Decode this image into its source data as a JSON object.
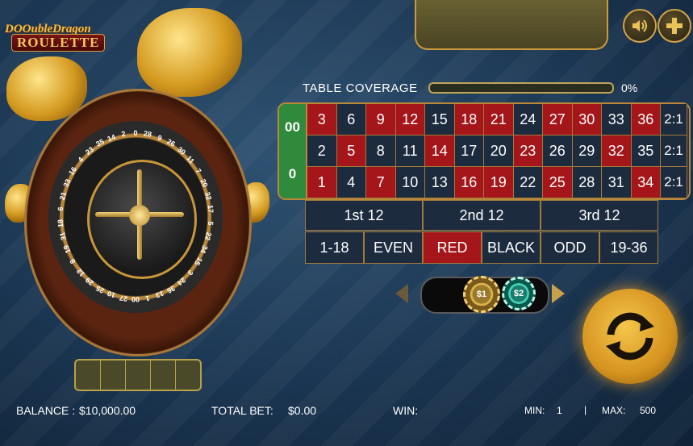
{
  "logo": {
    "line1": "DOOubleDragon",
    "line2": "ROULETTE"
  },
  "coverage": {
    "label": "TABLE COVERAGE",
    "percent_text": "0%",
    "fraction": 0.0
  },
  "table": {
    "zeros": [
      "00",
      "0"
    ],
    "rows": [
      [
        {
          "n": "3",
          "c": "red"
        },
        {
          "n": "6",
          "c": "black"
        },
        {
          "n": "9",
          "c": "red"
        },
        {
          "n": "12",
          "c": "red"
        },
        {
          "n": "15",
          "c": "black"
        },
        {
          "n": "18",
          "c": "red"
        },
        {
          "n": "21",
          "c": "red"
        },
        {
          "n": "24",
          "c": "black"
        },
        {
          "n": "27",
          "c": "red"
        },
        {
          "n": "30",
          "c": "red"
        },
        {
          "n": "33",
          "c": "black"
        },
        {
          "n": "36",
          "c": "red"
        },
        {
          "n": "2:1",
          "c": "col"
        }
      ],
      [
        {
          "n": "2",
          "c": "black"
        },
        {
          "n": "5",
          "c": "red"
        },
        {
          "n": "8",
          "c": "black"
        },
        {
          "n": "11",
          "c": "black"
        },
        {
          "n": "14",
          "c": "red"
        },
        {
          "n": "17",
          "c": "black"
        },
        {
          "n": "20",
          "c": "black"
        },
        {
          "n": "23",
          "c": "red"
        },
        {
          "n": "26",
          "c": "black"
        },
        {
          "n": "29",
          "c": "black"
        },
        {
          "n": "32",
          "c": "red"
        },
        {
          "n": "35",
          "c": "black"
        },
        {
          "n": "2:1",
          "c": "col"
        }
      ],
      [
        {
          "n": "1",
          "c": "red"
        },
        {
          "n": "4",
          "c": "black"
        },
        {
          "n": "7",
          "c": "red"
        },
        {
          "n": "10",
          "c": "black"
        },
        {
          "n": "13",
          "c": "black"
        },
        {
          "n": "16",
          "c": "red"
        },
        {
          "n": "19",
          "c": "red"
        },
        {
          "n": "22",
          "c": "black"
        },
        {
          "n": "25",
          "c": "red"
        },
        {
          "n": "28",
          "c": "black"
        },
        {
          "n": "31",
          "c": "black"
        },
        {
          "n": "34",
          "c": "red"
        },
        {
          "n": "2:1",
          "c": "col"
        }
      ]
    ],
    "dozens": [
      "1st 12",
      "2nd 12",
      "3rd 12"
    ],
    "outside": [
      {
        "label": "1-18",
        "c": "black"
      },
      {
        "label": "EVEN",
        "c": "black"
      },
      {
        "label": "RED",
        "c": "red"
      },
      {
        "label": "BLACK",
        "c": "black"
      },
      {
        "label": "ODD",
        "c": "black"
      },
      {
        "label": "19-36",
        "c": "black"
      }
    ]
  },
  "chips": {
    "chip1": "$1",
    "chip2": "$2"
  },
  "wheel": {
    "numbers": [
      "0",
      "28",
      "9",
      "26",
      "30",
      "11",
      "7",
      "20",
      "32",
      "17",
      "5",
      "22",
      "34",
      "15",
      "3",
      "24",
      "36",
      "13",
      "1",
      "00",
      "27",
      "10",
      "25",
      "29",
      "12",
      "8",
      "19",
      "31",
      "18",
      "6",
      "21",
      "33",
      "16",
      "4",
      "23",
      "35",
      "14",
      "2"
    ]
  },
  "footer": {
    "balance_label": "BALANCE :",
    "balance_value": "$10,000.00",
    "total_bet_label": "TOTAL BET:",
    "total_bet_value": "$0.00",
    "win_label": "WIN:",
    "min_label": "MIN:",
    "min_value": "1",
    "separator": "|",
    "max_label": "MAX:",
    "max_value": "500"
  },
  "colors": {
    "red": "#a5161a",
    "black": "#1d2b3e",
    "green": "#2f8a3c",
    "gold": "#c99b3a"
  },
  "icons": {
    "sound": "speaker-icon",
    "add": "plus-icon",
    "spin": "refresh-icon"
  }
}
